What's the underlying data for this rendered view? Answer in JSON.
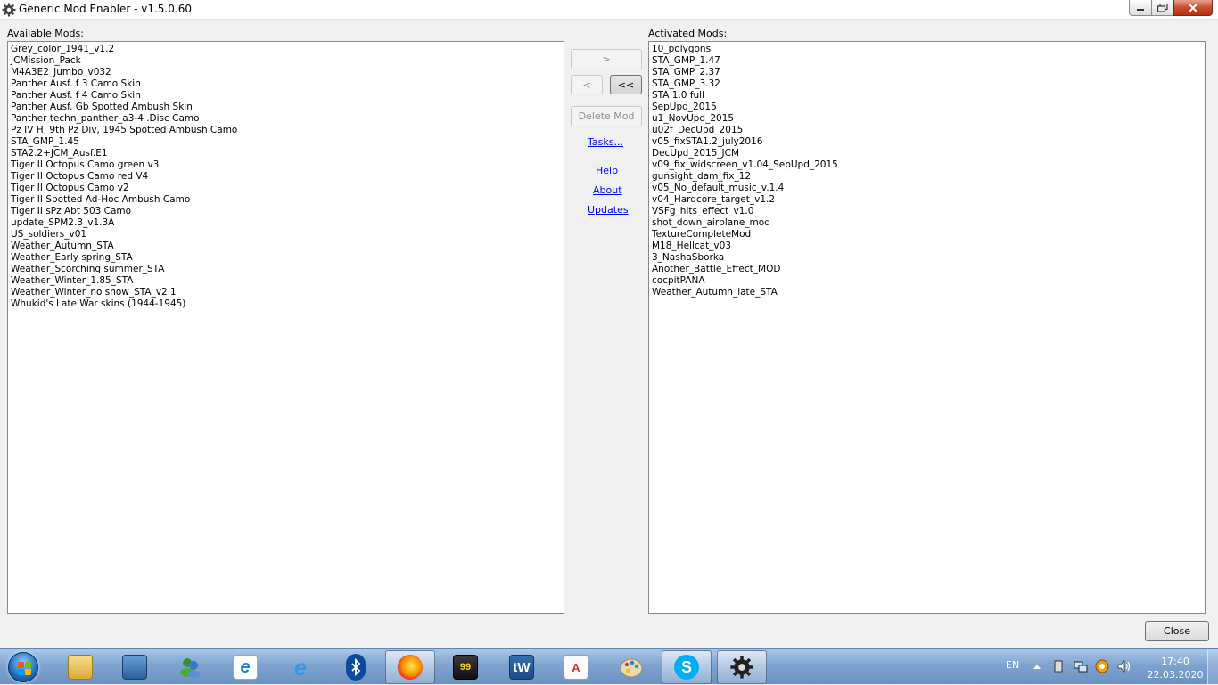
{
  "window": {
    "title": "Generic Mod Enabler - v1.5.0.60"
  },
  "available": {
    "label": "Available Mods:",
    "items": [
      "Grey_color_1941_v1.2",
      "JCMission_Pack",
      "M4A3E2_Jumbo_v032",
      "Panther Ausf. f 3 Camo Skin",
      "Panther Ausf. f 4 Camo Skin",
      "Panther Ausf. Gb Spotted Ambush Skin",
      "Panther techn_panther_a3-4 .Disc Camo",
      "Pz IV H, 9th Pz Div, 1945 Spotted Ambush Camo",
      "STA_GMP_1.45",
      "STA2.2+JCM_Ausf.E1",
      "Tiger II Octopus Camo green v3",
      "Tiger II Octopus Camo red V4",
      "Tiger II Octopus Camo v2",
      "Tiger II Spotted Ad-Hoc Ambush Camo",
      "Tiger II sPz Abt 503 Camo",
      "update_SPM2.3_v1.3A",
      "US_soldiers_v01",
      "Weather_Autumn_STA",
      "Weather_Early spring_STA",
      "Weather_Scorching summer_STA",
      "Weather_Winter_1.85_STA",
      "Weather_Winter_no snow_STA_v2.1",
      "Whukid's Late War skins (1944-1945)"
    ]
  },
  "activated": {
    "label": "Activated Mods:",
    "items": [
      "10_polygons",
      "STA_GMP_1.47",
      "STA_GMP_2.37",
      "STA_GMP_3.32",
      "STA 1.0 full",
      "SepUpd_2015",
      "u1_NovUpd_2015",
      "u02f_DecUpd_2015",
      "v05_fixSTA1.2_july2016",
      "DecUpd_2015_JCM",
      "v09_fix_widscreen_v1.04_SepUpd_2015",
      "gunsight_dam_fix_12",
      "v05_No_default_music_v.1.4",
      "v04_Hardcore_target_v1.2",
      "VSFg_hits_effect_v1.0",
      "shot_down_airplane_mod",
      "TextureCompleteMod",
      "M18_Hellcat_v03",
      "3_NashaSborka",
      "Another_Battle_Effect_MOD",
      "cocpitPANA",
      "Weather_Autumn_late_STA"
    ]
  },
  "controls": {
    "activate_label": ">",
    "deactivate_label": "<",
    "deactivate_all_label": "<<",
    "delete_label": "Delete Mod",
    "tasks_label": "Tasks...",
    "help_label": "Help",
    "about_label": "About",
    "updates_label": "Updates",
    "close_label": "Close"
  },
  "taskbar": {
    "language": "EN",
    "time": "17:40",
    "date": "22.03.2020",
    "apps": [
      "explorer-icon",
      "briefcase-icon",
      "messenger-icon",
      "internet-explorer-old-icon",
      "internet-explorer-icon",
      "bluetooth-icon",
      "firefox-icon",
      "security-tool-icon",
      "tw-app-icon",
      "document-viewer-icon",
      "paint-icon",
      "skype-icon",
      "mod-enabler-gear-icon"
    ]
  }
}
